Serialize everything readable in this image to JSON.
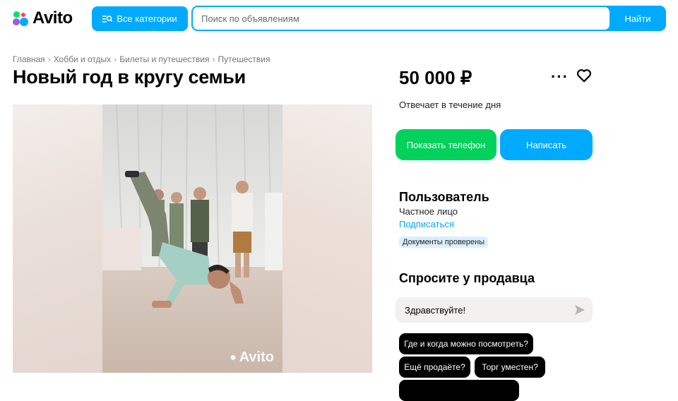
{
  "header": {
    "logo_text": "Avito",
    "categories_label": "Все категории",
    "search_placeholder": "Поиск по объявлениям",
    "search_value": "",
    "search_button": "Найти"
  },
  "breadcrumb": [
    "Главная",
    "Хобби и отдых",
    "Билеты и путешествия",
    "Путешествия"
  ],
  "listing": {
    "title": "Новый год в кругу семьи",
    "price": "50 000 ₽",
    "response_time": "Отвечает в течение дня",
    "photo_watermark": "Avito"
  },
  "actions": {
    "show_phone": "Показать телефон",
    "write": "Написать"
  },
  "seller": {
    "name": "Пользователь",
    "type": "Частное лицо",
    "subscribe": "Подписаться",
    "documents_badge": "Документы проверены"
  },
  "ask": {
    "title": "Спросите у продавца",
    "message_value": "Здравствуйте!",
    "quick_questions": [
      "Где и когда можно посмотреть?",
      "Ещё продаёте?",
      "Торг уместен?",
      ""
    ]
  },
  "colors": {
    "accent_blue": "#00aaff",
    "phone_green": "#02d15c",
    "logo_dots": [
      "#04e061",
      "#ff4053",
      "#965eeb",
      "#0af"
    ]
  },
  "icons": {
    "categories": "search-list-icon",
    "more": "more-icon",
    "favorite": "heart-icon",
    "send": "send-icon"
  }
}
